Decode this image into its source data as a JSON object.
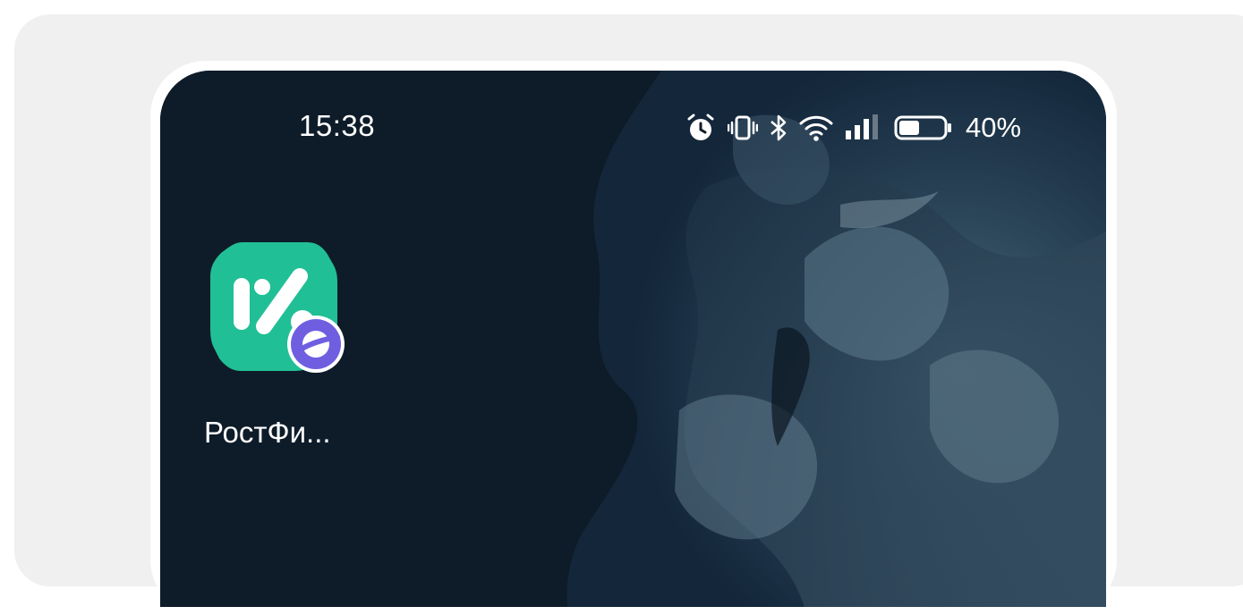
{
  "status_bar": {
    "time": "15:38",
    "icons": [
      "alarm-icon",
      "vibrate-icon",
      "bluetooth-icon",
      "wifi-icon",
      "signal-icon",
      "battery-icon"
    ],
    "battery_percent": "40%"
  },
  "home_screen": {
    "apps": [
      {
        "label": "РостФи...",
        "icon": "rostfin-app-icon",
        "badge": "browser-badge-icon"
      }
    ]
  },
  "colors": {
    "background": "#0e1b28",
    "app_icon": "#21bf95",
    "badge": "#6f5fe0"
  }
}
